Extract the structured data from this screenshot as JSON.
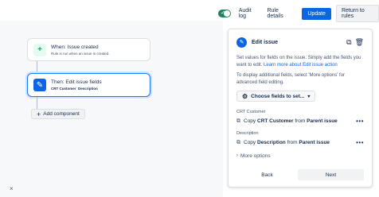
{
  "topbar": {
    "audit_log": "Audit log",
    "rule_details": "Rule details",
    "update": "Update",
    "return_to_rules": "Return to rules"
  },
  "canvas": {
    "trigger": {
      "title": "When: Issue created",
      "subtitle": "Rule is run when an issue is created."
    },
    "action": {
      "title": "Then: Edit issue fields",
      "fields": [
        "CRT Customer",
        "Description"
      ]
    },
    "add_component": "Add component",
    "close": "×"
  },
  "panel": {
    "title": "Edit issue",
    "desc_prefix": "Set values for fields on the issue. Simply add the fields you want to edit. ",
    "desc_link": "Learn more about Edit issue action",
    "desc2_prefix": "To display additional fields, select 'More options' for ",
    "desc2_link": "advanced field editing.",
    "choose_fields": "Choose fields to set...",
    "fields": [
      {
        "label": "CRT Customer",
        "copy": "Copy",
        "field": "CRT Customer",
        "from": "from",
        "source": "Parent issue"
      },
      {
        "label": "Description",
        "copy": "Copy",
        "field": "Description",
        "from": "from",
        "source": "Parent issue"
      }
    ],
    "more_options": "More options",
    "back": "Back",
    "next": "Next"
  }
}
